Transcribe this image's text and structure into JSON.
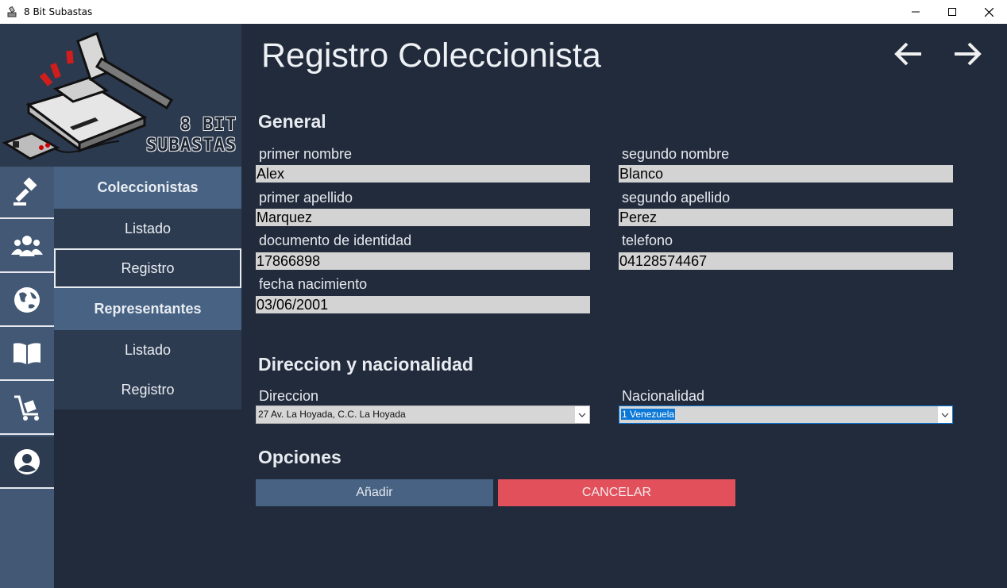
{
  "window": {
    "title": "8 Bit Subastas"
  },
  "logo": {
    "line1": "8 BIT",
    "line2": "SUBASTAS"
  },
  "rail": [
    {
      "icon": "gavel-icon"
    },
    {
      "icon": "users-icon"
    },
    {
      "icon": "globe-icon"
    },
    {
      "icon": "book-icon"
    },
    {
      "icon": "cart-icon"
    },
    {
      "icon": "user-circle-icon"
    }
  ],
  "submenu": {
    "section1": "Coleccionistas",
    "section1_item1": "Listado",
    "section1_item2": "Registro",
    "section2": "Representantes",
    "section2_item1": "Listado",
    "section2_item2": "Registro"
  },
  "page": {
    "title": "Registro Coleccionista"
  },
  "general": {
    "title": "General",
    "primer_nombre_label": "primer nombre",
    "primer_nombre": "Alex",
    "segundo_nombre_label": "segundo nombre",
    "segundo_nombre": "Blanco",
    "primer_apellido_label": "primer apellido",
    "primer_apellido": "Marquez",
    "segundo_apellido_label": "segundo apellido",
    "segundo_apellido": "Perez",
    "documento_label": "documento de identidad",
    "documento": "17866898",
    "telefono_label": "telefono",
    "telefono": "04128574467",
    "fecha_label": "fecha nacimiento",
    "fecha": "03/06/2001"
  },
  "direccion": {
    "title": "Direccion y nacionalidad",
    "direccion_label": "Direccion",
    "direccion_value": "27 Av. La Hoyada, C.C. La Hoyada",
    "nacionalidad_label": "Nacionalidad",
    "nacionalidad_value": "1 Venezuela"
  },
  "opciones": {
    "title": "Opciones",
    "add_label": "Añadir",
    "cancel_label": "CANCELAR"
  },
  "colors": {
    "background": "#222b3b",
    "sidebar": "#2d3b50",
    "accent": "#476283",
    "cancel": "#e1505b"
  }
}
